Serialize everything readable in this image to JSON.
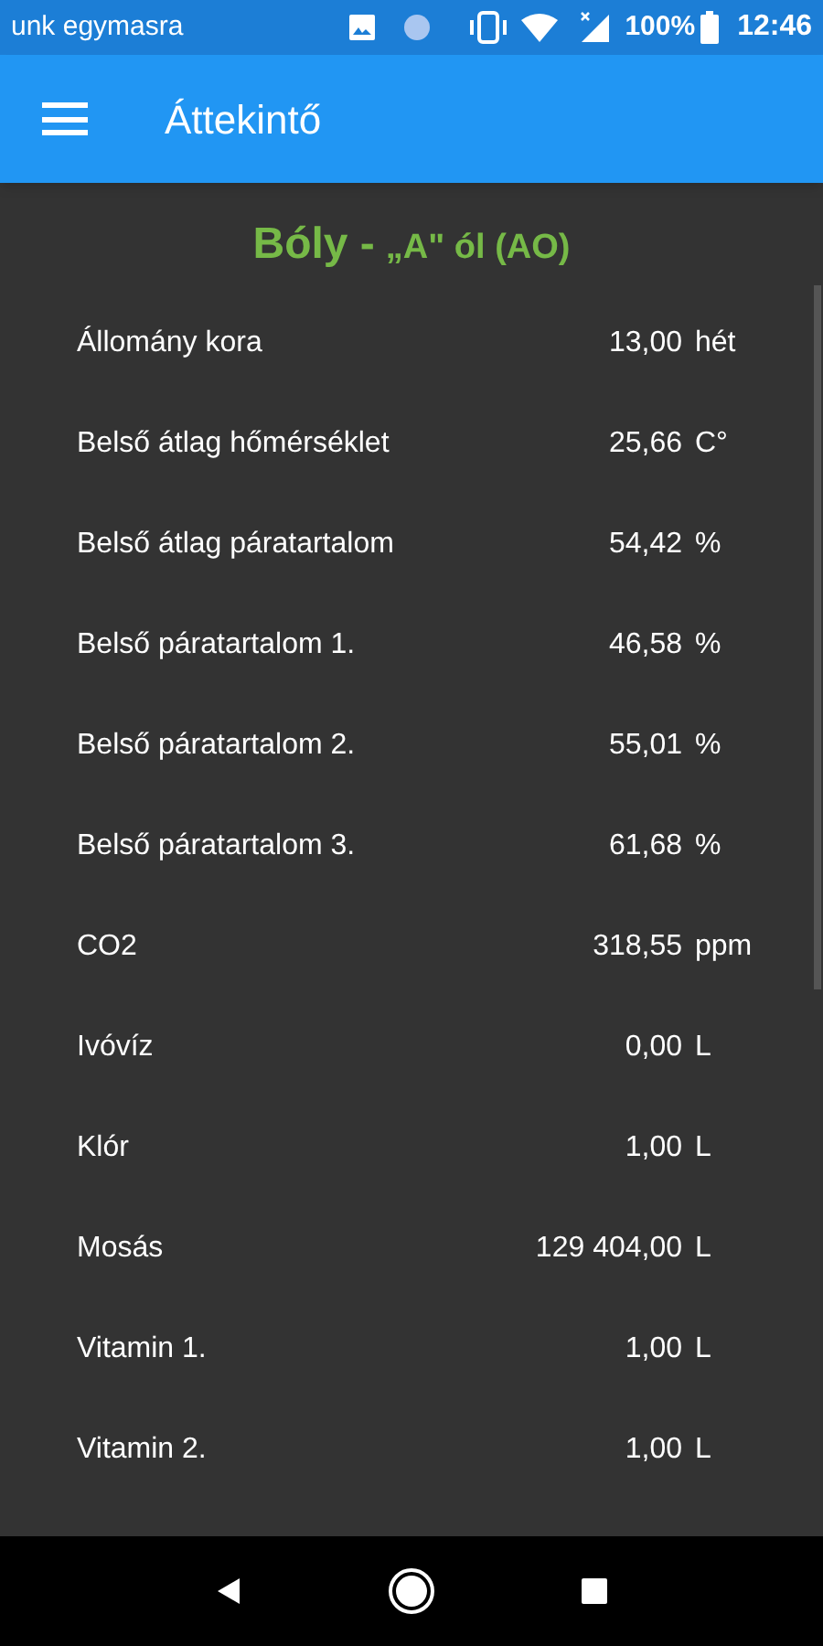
{
  "status_bar": {
    "notification": "unk egymasra",
    "battery": "100%",
    "time": "12:46"
  },
  "app_bar": {
    "title": "Áttekintő"
  },
  "heading": {
    "place": "Bóly -",
    "building": "„A\" ól (AO)"
  },
  "rows": [
    {
      "label": "Állomány kora",
      "value": "13,00",
      "unit": "hét"
    },
    {
      "label": "Belső átlag hőmérséklet",
      "value": "25,66",
      "unit": "C°"
    },
    {
      "label": "Belső átlag páratartalom",
      "value": "54,42",
      "unit": "%"
    },
    {
      "label": "Belső páratartalom 1.",
      "value": "46,58",
      "unit": "%"
    },
    {
      "label": "Belső páratartalom 2.",
      "value": "55,01",
      "unit": "%"
    },
    {
      "label": "Belső páratartalom 3.",
      "value": "61,68",
      "unit": "%"
    },
    {
      "label": "CO2",
      "value": "318,55",
      "unit": "ppm"
    },
    {
      "label": "Ivóvíz",
      "value": "0,00",
      "unit": "L"
    },
    {
      "label": "Klór",
      "value": "1,00",
      "unit": "L"
    },
    {
      "label": "Mosás",
      "value": "129 404,00",
      "unit": "L"
    },
    {
      "label": "Vitamin 1.",
      "value": "1,00",
      "unit": "L"
    },
    {
      "label": "Vitamin 2.",
      "value": "1,00",
      "unit": "L"
    }
  ]
}
